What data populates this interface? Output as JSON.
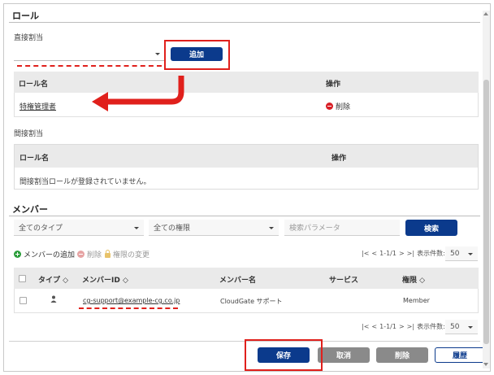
{
  "roles_section": {
    "title": "ロール",
    "direct": {
      "label": "直接割当",
      "add_button": "追加",
      "col_role": "ロール名",
      "col_action": "操作",
      "rows": [
        {
          "role": "特権管理者",
          "action": "削除"
        }
      ]
    },
    "indirect": {
      "label": "間接割当",
      "col_role": "ロール名",
      "col_action": "操作",
      "empty_message": "間接割当ロールが登録されていません。"
    }
  },
  "members_section": {
    "title": "メンバー",
    "filter_type": "全てのタイプ",
    "filter_permission": "全ての権限",
    "search_placeholder": "検索パラメータ",
    "search_button": "検索",
    "actions": {
      "add": "メンバーの追加",
      "delete": "削除",
      "change_permission": "権限の変更"
    },
    "pager": {
      "range": "1-1/1",
      "per_page_label": "表示件数:",
      "per_page_value": "50"
    },
    "columns": {
      "type": "タイプ ◇",
      "member_id": "メンバーID ◇",
      "member_name": "メンバー名",
      "service": "サービス",
      "permission": "権限 ◇"
    },
    "rows": [
      {
        "type_icon": "user-icon",
        "member_id": "cg-support@example-cg.co.jp",
        "member_name": "CloudGate サポート",
        "service": "",
        "permission": "Member"
      }
    ]
  },
  "footer": {
    "save": "保存",
    "cancel": "取消",
    "delete": "削除",
    "history": "履歴"
  },
  "colors": {
    "primary": "#0b3a8c",
    "annotation_red": "#e0201c",
    "delete_red": "#d81f26",
    "add_green": "#2a9d3a"
  }
}
